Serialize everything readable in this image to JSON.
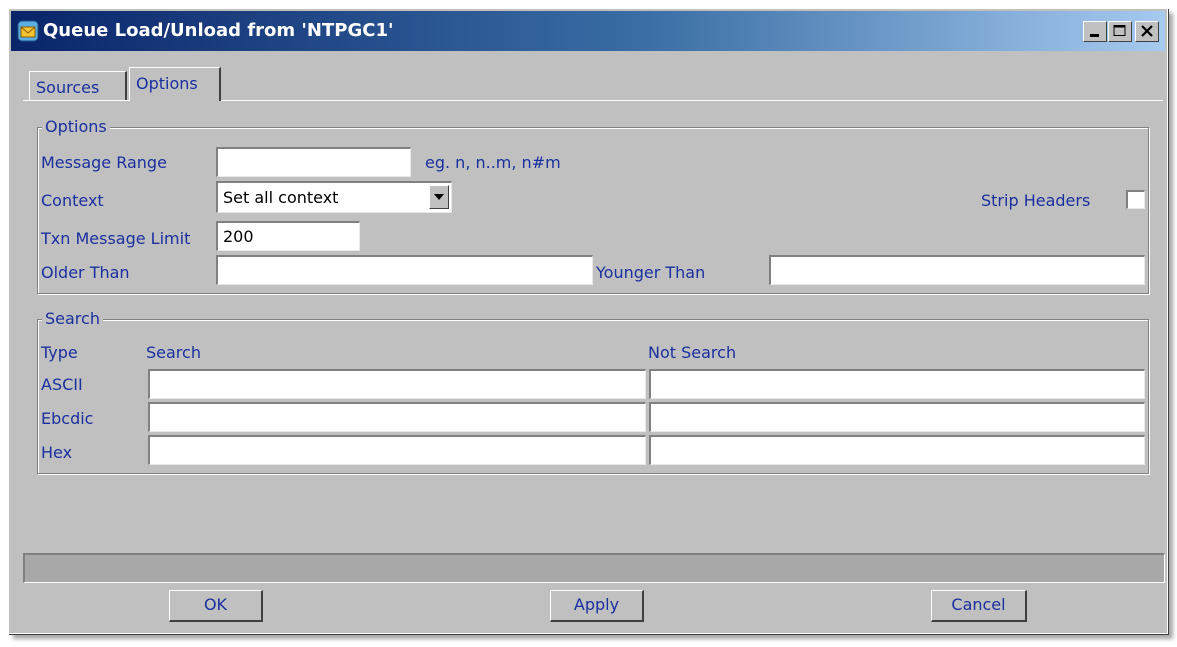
{
  "window": {
    "title": "Queue Load/Unload from 'NTPGC1'"
  },
  "title_buttons": {
    "minimize": "minimize-icon",
    "maximize": "maximize-icon",
    "close": "close-icon"
  },
  "tabs": [
    {
      "label": "Sources",
      "active": false
    },
    {
      "label": "Options",
      "active": true
    }
  ],
  "options_group": {
    "title": "Options",
    "message_range": {
      "label": "Message Range",
      "value": "",
      "hint": "eg. n, n..m, n#m"
    },
    "context": {
      "label": "Context",
      "value": "Set all context"
    },
    "strip_headers": {
      "label": "Strip Headers",
      "checked": false
    },
    "txn_limit": {
      "label": "Txn Message Limit",
      "value": "200"
    },
    "older_than": {
      "label": "Older Than",
      "value": ""
    },
    "younger_than": {
      "label": "Younger Than",
      "value": ""
    }
  },
  "search_group": {
    "title": "Search",
    "headers": {
      "type": "Type",
      "search": "Search",
      "not_search": "Not Search"
    },
    "rows": [
      {
        "type": "ASCII",
        "search": "",
        "not_search": ""
      },
      {
        "type": "Ebcdic",
        "search": "",
        "not_search": ""
      },
      {
        "type": "Hex",
        "search": "",
        "not_search": ""
      }
    ]
  },
  "status": {
    "text": ""
  },
  "buttons": {
    "ok": "OK",
    "apply": "Apply",
    "cancel": "Cancel"
  },
  "colors": {
    "label_blue": "#1a2fa0",
    "face": "#c0c0c0",
    "title_start": "#0a246a",
    "title_end": "#a6caf0"
  }
}
